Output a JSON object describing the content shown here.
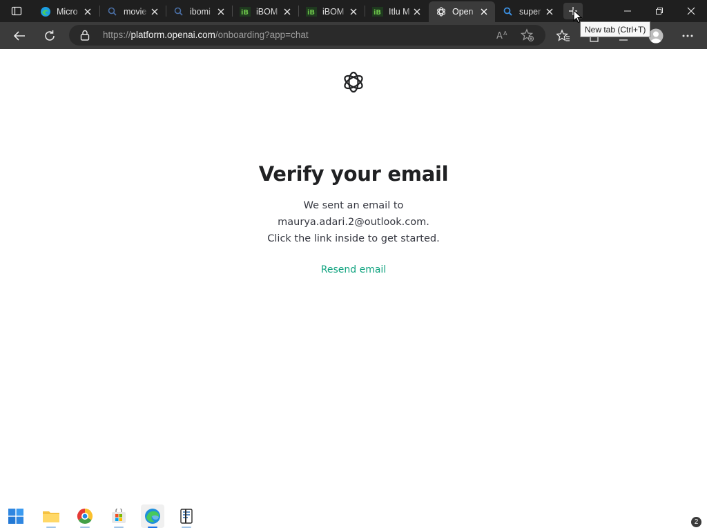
{
  "browser": {
    "tabs": [
      {
        "title": "Micro",
        "icon": "edge-icon",
        "active": false
      },
      {
        "title": "movie",
        "icon": "search-icon",
        "active": false
      },
      {
        "title": "ibomi",
        "icon": "search-icon",
        "active": false
      },
      {
        "title": "iBOM",
        "icon": "ibom-icon",
        "active": false
      },
      {
        "title": "iBOM",
        "icon": "ibom-icon",
        "active": false
      },
      {
        "title": "Itlu M",
        "icon": "ibom-icon",
        "active": false
      },
      {
        "title": "Open",
        "icon": "openai-icon",
        "active": true
      },
      {
        "title": "super",
        "icon": "search-icon",
        "active": false
      }
    ],
    "url_scheme": "https://",
    "url_host": "platform.openai.com",
    "url_path": "/onboarding?app=chat",
    "tooltip": "New tab (Ctrl+T)"
  },
  "page": {
    "heading": "Verify your email",
    "message_line1": "We sent an email to",
    "email": "maurya.adari.2@outlook.com.",
    "message_line3": "Click the link inside to get started.",
    "resend_label": "Resend email"
  },
  "taskbar": {
    "apps": [
      "start-icon",
      "file-explorer-icon",
      "chrome-icon",
      "store-icon",
      "edge-icon",
      "reader-icon"
    ],
    "notification_count": "2"
  },
  "colors": {
    "accent_green": "#10a37f",
    "tab_bar": "#1f1f1f",
    "toolbar": "#3b3b3b",
    "heading": "#202123"
  }
}
